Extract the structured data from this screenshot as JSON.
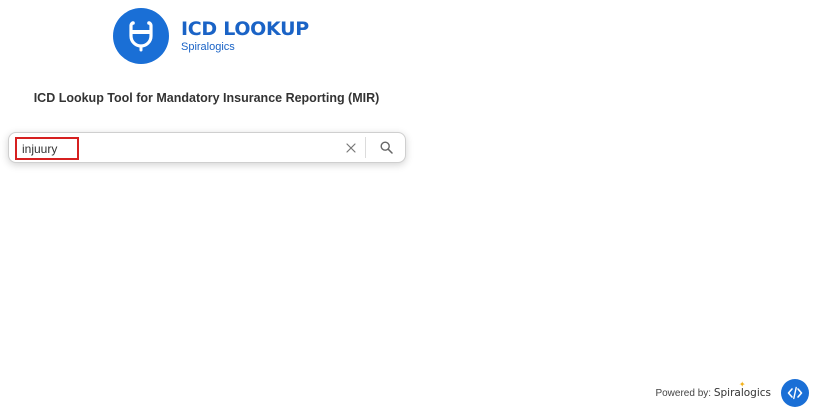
{
  "logo": {
    "title": "ICD LOOKUP",
    "subtitle": "Spiralogics",
    "icon": "stethoscope-icon",
    "color": "#1a6fd6"
  },
  "tagline": "ICD Lookup Tool for Mandatory Insurance Reporting (MIR)",
  "search": {
    "value": "injuury",
    "placeholder": "",
    "clear_icon": "close-icon",
    "search_icon": "search-icon",
    "highlight_color": "#d62020"
  },
  "footer": {
    "powered_label": "Powered by:",
    "brand": "Spiralogics",
    "widget_icon": "code-icon"
  }
}
